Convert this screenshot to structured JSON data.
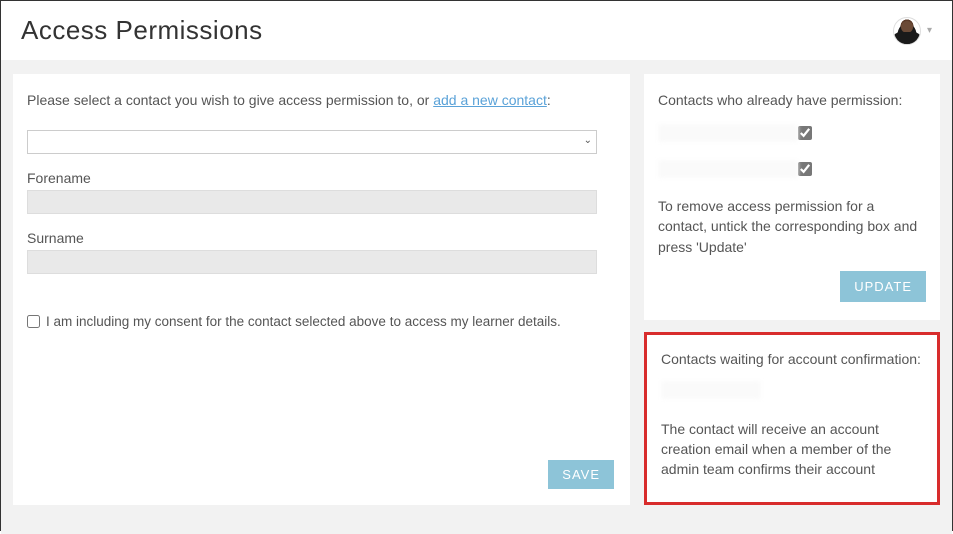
{
  "header": {
    "title": "Access Permissions"
  },
  "left": {
    "intro_prefix": "Please select a contact you wish to give access permission to, or ",
    "intro_link": "add a new contact",
    "intro_suffix": ":",
    "forename_label": "Forename",
    "surname_label": "Surname",
    "forename_value": "",
    "surname_value": "",
    "consent_text": "I am including my consent for the contact selected above to access my learner details.",
    "save_label": "SAVE"
  },
  "right": {
    "heading": "Contacts who already have permission:",
    "contacts": [
      {
        "name": "",
        "checked": true
      },
      {
        "name": "",
        "checked": true
      }
    ],
    "remove_text": "To remove access permission for a contact, untick the corresponding box and press 'Update'",
    "update_label": "UPDATE"
  },
  "waiting": {
    "heading": "Contacts waiting for account confirmation:",
    "pending_name": "",
    "info_text": "The contact will receive an account creation email when a member of the admin team confirms their account"
  }
}
